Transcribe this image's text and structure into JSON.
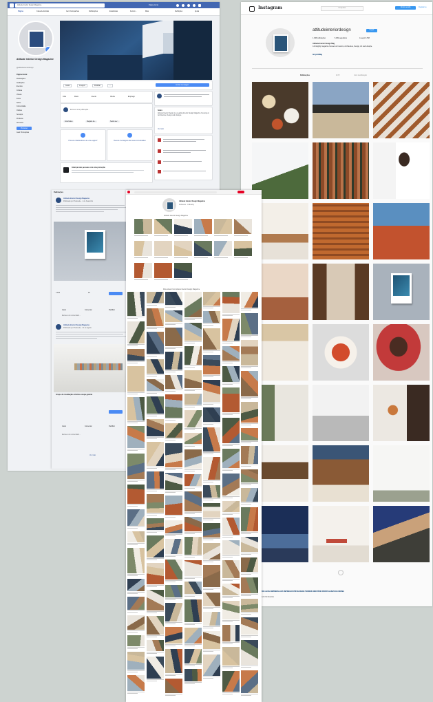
{
  "facebook": {
    "search": "Attitude Interior Design Magazine",
    "nav_tabs": [
      "Página",
      "Caixa de Entrada",
      "Gerir Campanhas",
      "Notificações",
      "Estatísticas",
      "Ferram...",
      "Mais"
    ],
    "nav_right": [
      "Definições",
      "Ajuda"
    ],
    "page_name": "Attitude Interior Design Magazine",
    "page_handle": "@attitudeinteriordesign",
    "sidebar_items": [
      "Página inicial",
      "Publicações",
      "Avaliações",
      "Eventos",
      "Críticas",
      "Vídeos",
      "Fotos",
      "Sobre",
      "Comunidade",
      "Ofertas",
      "Serviços",
      "Produtos",
      "Anúncios"
    ],
    "sidebar_button": "Promover",
    "sidebar_footer": "Gerir Promoções",
    "action_buttons": [
      "Gosto",
      "A seguir",
      "Partilhar",
      "..."
    ],
    "cta_button": "Enviar mensagem",
    "composer_tabs": [
      "Criar",
      "Direto",
      "Evento",
      "Oferta",
      "Emprego"
    ],
    "composer_placeholder": "Escreve uma publicação...",
    "composer_chips": [
      "Foto/vídeo",
      "Registo de...",
      "Sentir-se/..."
    ],
    "help_card_1": "Procura colaboradores de uma equipa?",
    "help_card_2": "Recebe mensagens das suas comunidades",
    "promo_title": "Alcança mais pessoas com uma promoção",
    "about_title": "Sobre",
    "about_text": "Attitude Interior Design is a Leading Interior Design Magazine focusing on Architecture, Design and Lifestyle.",
    "see_all": "Ver tudo",
    "feed_header": "Publicações",
    "posts": [
      {
        "author": "Attitude Interior Design Magazine",
        "meta": "Publicado por Hootsuite · 1 de Setembro",
        "stats": [
          "1.142",
          "10"
        ],
        "actions": [
          "Gosto",
          "Comentar",
          "Partilhar"
        ],
        "comment": "Escreve um comentário..."
      },
      {
        "author": "Attitude Interior Design Magazine",
        "meta": "Publicado por Hootsuite · 31 de Agosto",
        "link_title": "Grupo de instalação artística ocupa galeria",
        "actions": [
          "Gosto",
          "Comentar",
          "Partilhar"
        ],
        "comment": "Escreve um comentário..."
      }
    ],
    "see_more": "Ver mais"
  },
  "instagram": {
    "logo": "Instagram",
    "search_placeholder": "Pesquisar",
    "username": "attitudeinteriordesign",
    "edit_button": "Seguir",
    "counts": [
      "1.158 publicações",
      "6.499 seguidores",
      "A seguir 1.593"
    ],
    "bio_name": "Attitude Interior Design Mag",
    "bio_text": "A fortnightly magazine focused on Interiors, Architecture, Design, Art and Lifestyle.",
    "bio_link": "bit.ly/AttMag",
    "tabs": [
      "Publicações",
      "IGTV",
      "Com identificação"
    ],
    "top_buttons": [
      "Iniciar sessão",
      "Registar-te"
    ],
    "footer_links": [
      "SOBRE",
      "AJUDA",
      "IMPRENSA",
      "API",
      "EMPREGOS",
      "PRIVACIDADE",
      "TERMOS",
      "DIRETÓRIO",
      "PERFIS",
      "HASHTAGS",
      "IDIOMA"
    ],
    "footer_copy": "© 2020 INSTAGRAM"
  },
  "pinterest": {
    "profile_name": "Attitude Interior Design Magazine",
    "profile_meta": "Followers · Following",
    "board_title": "Attitude Interior Design Magazine",
    "section_title": "More ideas from Attitude Interior Design Magazine"
  },
  "colors": {
    "fb_blue": "#4267b2",
    "action_blue": "#4a8af4",
    "ig_blue": "#3897f0",
    "pin_red": "#e60023",
    "backdrop": "#cdd3d0"
  }
}
